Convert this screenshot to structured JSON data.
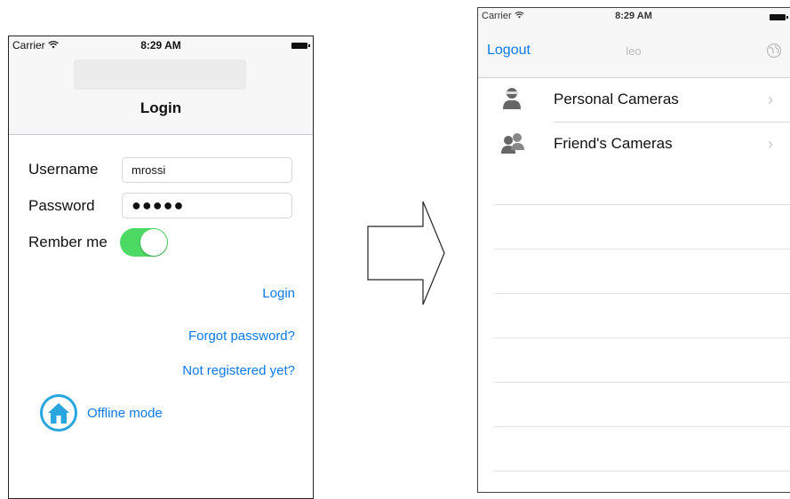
{
  "login_screen": {
    "status": {
      "carrier": "Carrier",
      "time": "8:29 AM"
    },
    "nav_title": "Login",
    "form": {
      "username_label": "Username",
      "username_value": "mrossi",
      "password_label": "Password",
      "password_value": "●●●●●",
      "remember_label": "Rember me",
      "remember_on": true
    },
    "links": {
      "login": "Login",
      "forgot": "Forgot password?",
      "register": "Not registered yet?"
    },
    "offline": {
      "label": "Offline mode",
      "icon": "home-icon"
    },
    "colors": {
      "link": "#0a7ae8",
      "toggle": "#4cd964",
      "offline_ring": "#2aa6df"
    }
  },
  "cameras_screen": {
    "status": {
      "carrier": "Carrier",
      "time": "8:29 AM"
    },
    "nav": {
      "logout": "Logout",
      "title": "leo",
      "right_icon": "globe-icon"
    },
    "rows": [
      {
        "label": "Personal Cameras",
        "icon": "person-icon"
      },
      {
        "label": "Friend's Cameras",
        "icon": "people-icon"
      }
    ]
  }
}
